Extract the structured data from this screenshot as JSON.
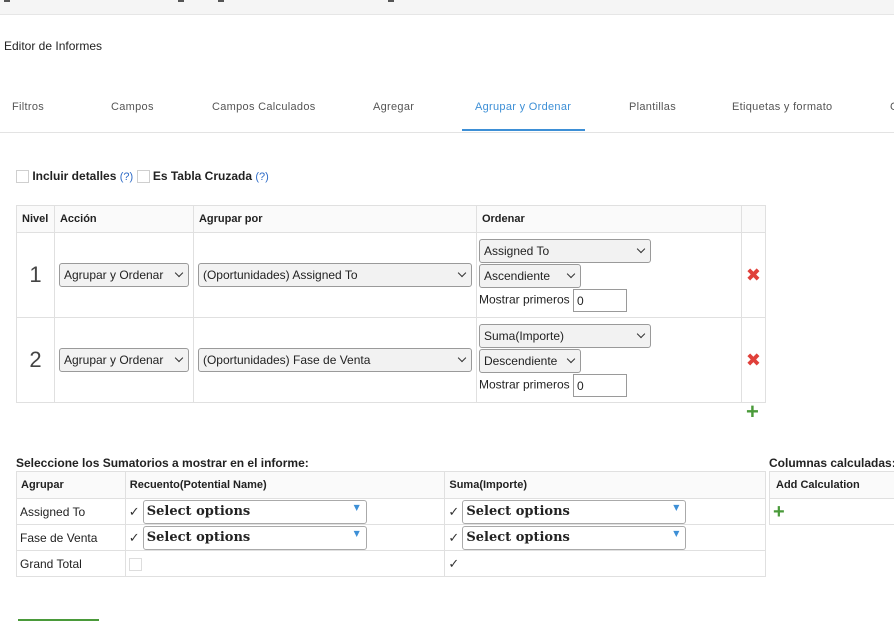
{
  "page": {
    "title": "Editor de Informes"
  },
  "tabs": [
    {
      "label": "Filtros"
    },
    {
      "label": "Campos"
    },
    {
      "label": "Campos Calculados"
    },
    {
      "label": "Agregar"
    },
    {
      "label": "Agrupar y Ordenar",
      "active": true
    },
    {
      "label": "Plantillas"
    },
    {
      "label": "Etiquetas y formato"
    },
    {
      "label": "C"
    }
  ],
  "options": {
    "include_details": "Incluir detalles",
    "crosstab": "Es Tabla Cruzada",
    "help": "(?)"
  },
  "grouping": {
    "headers": {
      "level": "Nivel",
      "action": "Acción",
      "group_by": "Agrupar por",
      "order": "Ordenar"
    },
    "show_first_label": "Mostrar primeros",
    "rows": [
      {
        "level": "1",
        "action": "Agrupar y Ordenar",
        "group_by": "(Oportunidades) Assigned To",
        "order_field": "Assigned To",
        "direction": "Ascendiente",
        "show_first": "0"
      },
      {
        "level": "2",
        "action": "Agrupar y Ordenar",
        "group_by": "(Oportunidades) Fase de Venta",
        "order_field": "Suma(Importe)",
        "direction": "Descendiente",
        "show_first": "0"
      }
    ]
  },
  "summaries": {
    "label": "Seleccione los Sumatorios a mostrar en el informe:",
    "headers": {
      "group": "Agrupar",
      "count": "Recuento(Potential Name)",
      "sum": "Suma(Importe)"
    },
    "placeholder": "Select options",
    "rows": [
      {
        "group": "Assigned To"
      },
      {
        "group": "Fase de Venta"
      },
      {
        "group": "Grand Total"
      }
    ]
  },
  "calculated": {
    "label": "Columnas calculadas:",
    "add": "Add Calculation"
  },
  "icons": {
    "delete": "close-icon",
    "add": "plus-icon",
    "check": "check-icon"
  },
  "colors": {
    "accent": "#3d8fd6",
    "delete": "#e0403a",
    "add": "#4a9a3a"
  }
}
